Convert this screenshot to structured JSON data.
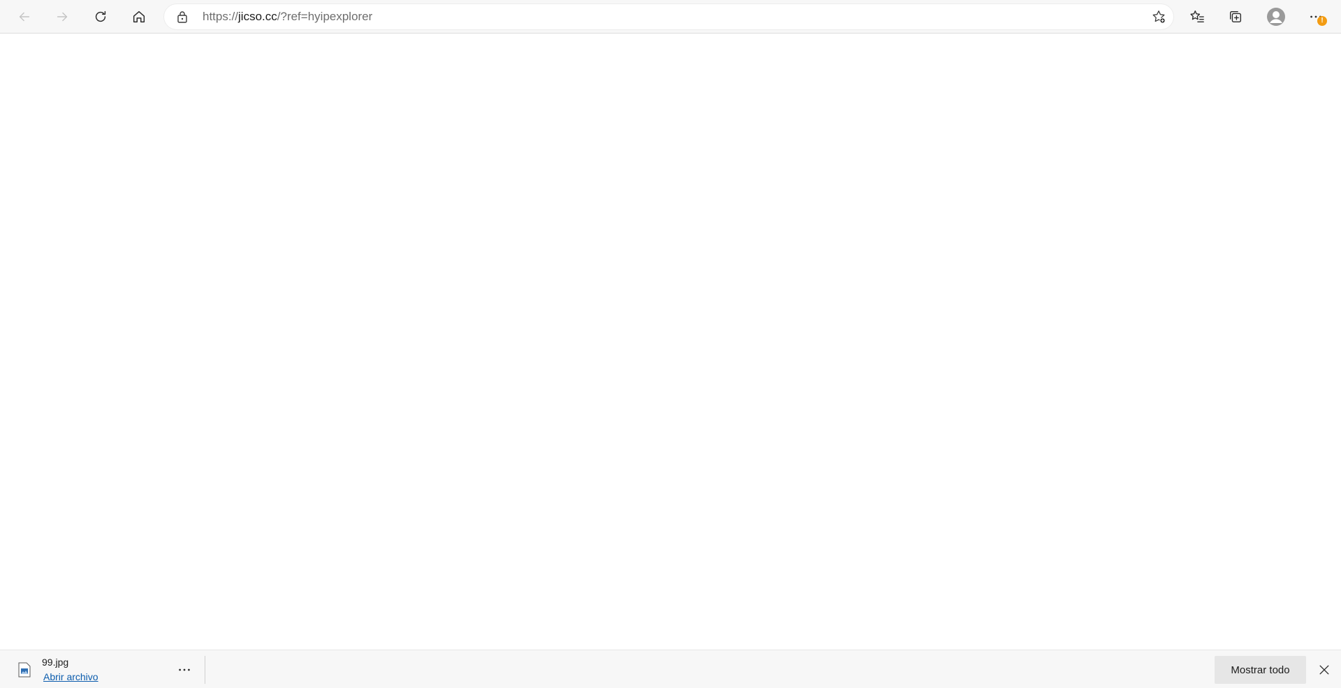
{
  "browser": {
    "address": {
      "scheme": "https://",
      "host": "jicso.cc",
      "rest": "/?ref=hyipexplorer"
    },
    "icons": {
      "back": "arrow-left-icon",
      "forward": "arrow-right-icon",
      "refresh": "refresh-icon",
      "home": "home-icon",
      "lock": "lock-icon",
      "add_favorite": "star-plus-icon",
      "favorites": "favorites-icon",
      "collections": "collections-icon",
      "profile": "avatar-icon",
      "menu": "more-icon"
    },
    "update_badge": "!",
    "badge_color": "#f39c12"
  },
  "downloads": {
    "file_name": "99.jpg",
    "open_label": "Abrir archivo",
    "show_all_label": "Mostrar todo",
    "link_color": "#0b5cad"
  }
}
